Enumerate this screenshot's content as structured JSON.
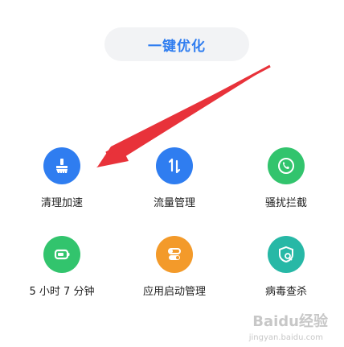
{
  "optimize": {
    "label": "一键优化"
  },
  "tiles": [
    {
      "label": "清理加速",
      "icon": "broom-icon",
      "color": "#2f7df0"
    },
    {
      "label": "流量管理",
      "icon": "traffic-arrows-icon",
      "color": "#2f7df0"
    },
    {
      "label": "骚扰拦截",
      "icon": "phone-shield-icon",
      "color": "#32c46d"
    },
    {
      "label": "5 小时 7 分钟",
      "icon": "battery-icon",
      "color": "#32c46d"
    },
    {
      "label": "应用启动管理",
      "icon": "toggle-app-icon",
      "color": "#f39a2a"
    },
    {
      "label": "病毒查杀",
      "icon": "virus-scan-icon",
      "color": "#27b8a6"
    }
  ],
  "annotation": {
    "color": "#e8323a"
  },
  "watermark": {
    "text": "Baidu经验",
    "sub": "jingyan.baidu.com"
  }
}
